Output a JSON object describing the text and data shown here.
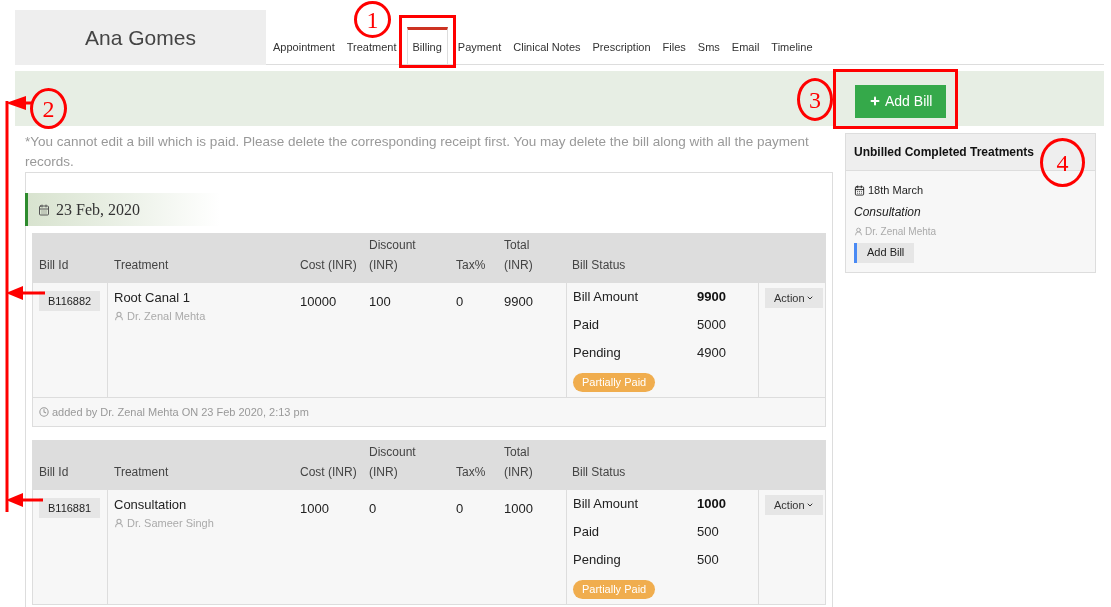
{
  "patient": {
    "name": "Ana Gomes"
  },
  "tabs": [
    {
      "label": "Appointment",
      "selected": false
    },
    {
      "label": "Treatment",
      "selected": false
    },
    {
      "label": "Billing",
      "selected": true
    },
    {
      "label": "Payment",
      "selected": false
    },
    {
      "label": "Clinical Notes",
      "selected": false
    },
    {
      "label": "Prescription",
      "selected": false
    },
    {
      "label": "Files",
      "selected": false
    },
    {
      "label": "Sms",
      "selected": false
    },
    {
      "label": "Email",
      "selected": false
    },
    {
      "label": "Timeline",
      "selected": false
    }
  ],
  "toolbar": {
    "add_button": "Add Bill"
  },
  "note": "*You cannot edit a bill which is paid. Please delete the corresponding receipt first. You may delete the bill along with all the payment records.",
  "bill_groups": [
    {
      "date": "23 Feb, 2020",
      "bills": [
        {
          "columns": [
            "Bill Id",
            "Treatment",
            "Cost (INR)",
            "Discount (INR)",
            "Tax%",
            "Total (INR)",
            "Bill Status"
          ],
          "bill_id": "B116882",
          "treatment": "Root Canal 1",
          "doctor": "Dr. Zenal Mehta",
          "cost": "10000",
          "discount": "100",
          "tax": "0",
          "total": "9900",
          "status_lines": [
            {
              "kind": "total",
              "label": "Bill Amount",
              "value": "9900"
            },
            {
              "kind": "part",
              "label": "Paid",
              "value": "5000"
            },
            {
              "kind": "part",
              "label": "Pending",
              "value": "4900"
            }
          ],
          "status_badge": "Partially Paid",
          "action": "Action",
          "added_by": "added by Dr. Zenal Mehta ON 23 Feb 2020, 2:13 pm"
        },
        {
          "columns": [
            "Bill Id",
            "Treatment",
            "Cost (INR)",
            "Discount (INR)",
            "Tax%",
            "Total (INR)",
            "Bill Status"
          ],
          "bill_id": "B116881",
          "treatment": "Consultation",
          "doctor": "Dr. Sameer Singh",
          "cost": "1000",
          "discount": "0",
          "tax": "0",
          "total": "1000",
          "status_lines": [
            {
              "kind": "total",
              "label": "Bill Amount",
              "value": "1000"
            },
            {
              "kind": "part",
              "label": "Paid",
              "value": "500"
            },
            {
              "kind": "part",
              "label": "Pending",
              "value": "500"
            }
          ],
          "status_badge": "Partially Paid",
          "action": "Action"
        }
      ]
    }
  ],
  "unbilled_treatments": {
    "title": "Unbilled Completed Treatments",
    "items": [
      {
        "date": "18th March",
        "treatment": "Consultation",
        "doctor": "Dr. Zenal Mehta",
        "action": "Add Bill"
      }
    ]
  },
  "annotations": [
    {
      "label": "1"
    },
    {
      "label": "2"
    },
    {
      "label": "3"
    },
    {
      "label": "4"
    }
  ]
}
